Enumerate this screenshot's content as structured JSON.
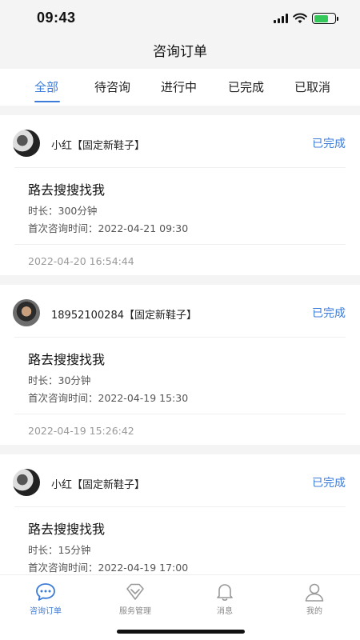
{
  "status": {
    "time": "09:43"
  },
  "nav": {
    "title": "咨询订单"
  },
  "tabs": [
    {
      "label": "全部",
      "active": true
    },
    {
      "label": "待咨询"
    },
    {
      "label": "进行中"
    },
    {
      "label": "已完成"
    },
    {
      "label": "已取消"
    }
  ],
  "orders": [
    {
      "name": "小红【固定新鞋子】",
      "status": "已完成",
      "topic": "路去搜搜找我",
      "duration": "时长：300分钟",
      "first_time": "首次咨询时间：2022-04-21 09:30",
      "created": "2022-04-20 16:54:44"
    },
    {
      "name": "18952100284【固定新鞋子】",
      "status": "已完成",
      "topic": "路去搜搜找我",
      "duration": "时长：30分钟",
      "first_time": "首次咨询时间：2022-04-19 15:30",
      "created": "2022-04-19 15:26:42"
    },
    {
      "name": "小红【固定新鞋子】",
      "status": "已完成",
      "topic": "路去搜搜找我",
      "duration": "时长：15分钟",
      "first_time": "首次咨询时间：2022-04-19 17:00",
      "created": ""
    }
  ],
  "tabbar": [
    {
      "label": "咨询订单",
      "icon": "chat-icon",
      "active": true
    },
    {
      "label": "服务管理",
      "icon": "diamond-icon"
    },
    {
      "label": "消息",
      "icon": "bell-icon"
    },
    {
      "label": "我的",
      "icon": "user-icon"
    }
  ],
  "colors": {
    "accent": "#3c7bd8",
    "background": "#f4f4f4"
  }
}
